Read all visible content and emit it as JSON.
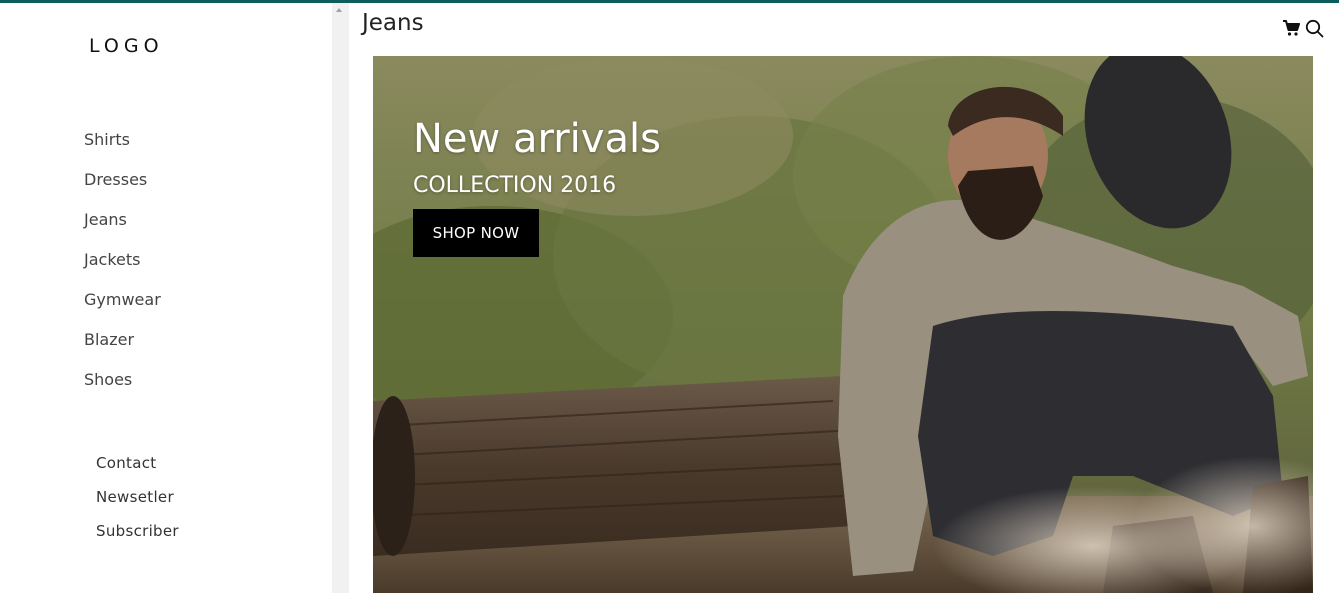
{
  "sidebar": {
    "logo": "LOGO",
    "categories": [
      {
        "label": "Shirts"
      },
      {
        "label": "Dresses"
      },
      {
        "label": "Jeans"
      },
      {
        "label": "Jackets"
      },
      {
        "label": "Gymwear"
      },
      {
        "label": "Blazer"
      },
      {
        "label": "Shoes"
      }
    ],
    "footer_links": [
      {
        "label": "Contact"
      },
      {
        "label": "Newsetler"
      },
      {
        "label": "Subscriber"
      }
    ]
  },
  "header": {
    "title": "Jeans",
    "icons": [
      "cart-icon",
      "search-icon"
    ]
  },
  "hero": {
    "title": "New arrivals",
    "subtitle": "COLLECTION 2016",
    "button_label": "SHOP NOW"
  },
  "colors": {
    "accent_bar": "#0c5e5e",
    "button_bg": "#000000"
  }
}
